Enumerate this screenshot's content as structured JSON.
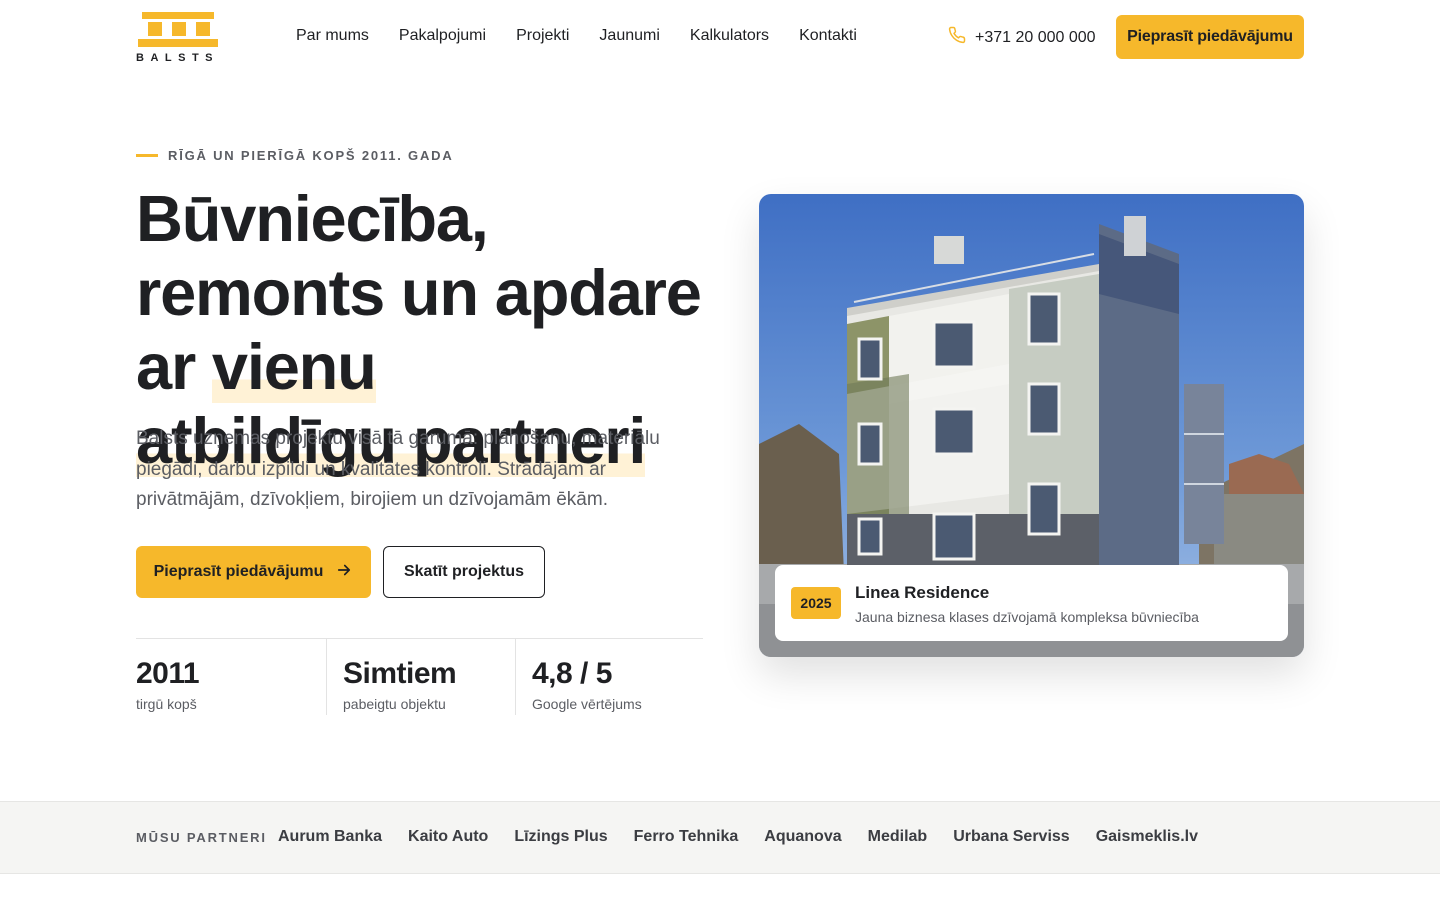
{
  "brand": {
    "name": "BALSTS",
    "accent": "#f6b82b",
    "text": "#1f2023",
    "muted": "#5b5d63"
  },
  "nav": {
    "items": [
      {
        "label": "Par mums"
      },
      {
        "label": "Pakalpojumi"
      },
      {
        "label": "Projekti"
      },
      {
        "label": "Jaunumi"
      },
      {
        "label": "Kalkulators"
      },
      {
        "label": "Kontakti"
      }
    ]
  },
  "header": {
    "phone_icon": "phone-icon",
    "phone": "+371 20 000 000",
    "cta_label": "Pieprasīt piedāvājumu"
  },
  "hero": {
    "eyebrow": "RĪGĀ UN PIERĪGĀ KOPŠ 2011. GADA",
    "headline_part1": "Būvniecība, remonts un apdare ar ",
    "headline_highlight1": "vienu",
    "headline_highlight2": "atbildīgu partneri",
    "lead": "Balsts uzņemas projektu visā tā garumā: plānošanu, materiālu piegādi, darbu izpildi un kvalitātes kontroli. Strādājam ar privātmājām, dzīvokļiem, birojiem un dzīvojamām ēkām.",
    "primary_cta": "Pieprasīt piedāvājumu",
    "primary_cta_icon": "arrow-right-icon",
    "secondary_cta": "Skatīt projektus",
    "stats": [
      {
        "value": "2011",
        "label": "tirgū kopš"
      },
      {
        "value": "Simtiem",
        "label": "pabeigtu objektu"
      },
      {
        "value": "4,8 / 5",
        "label": "Google vērtējums"
      }
    ]
  },
  "project": {
    "year": "2025",
    "title": "Linea Residence",
    "subtitle": "Jauna biznesa klases dzīvojamā kompleksa būvniecība"
  },
  "partners": {
    "label": "MŪSU PARTNERI",
    "items": [
      "Aurum Banka",
      "Kaito Auto",
      "Līzings Plus",
      "Ferro Tehnika",
      "Aquanova",
      "Medilab",
      "Urbana Serviss",
      "Gaismeklis.lv"
    ]
  }
}
